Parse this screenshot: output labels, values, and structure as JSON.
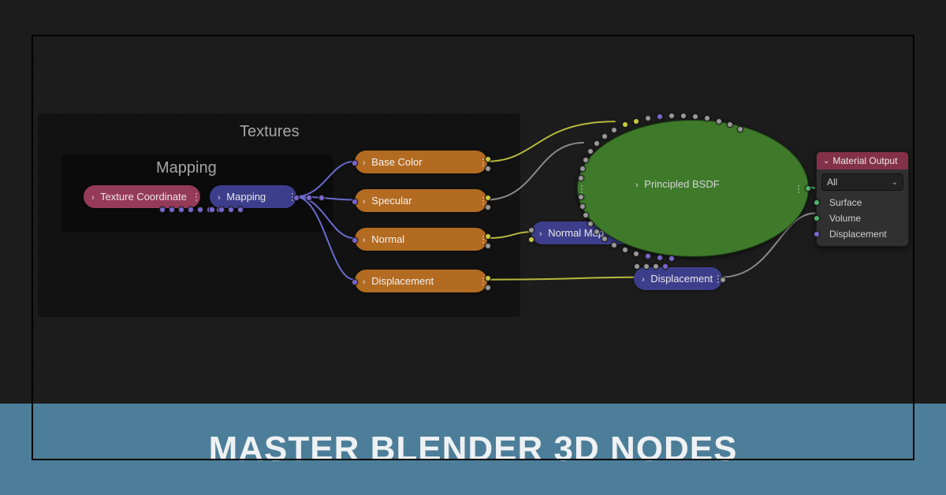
{
  "banner": {
    "title": "MASTER BLENDER 3D NODES"
  },
  "frames": {
    "textures_label": "Textures",
    "mapping_label": "Mapping"
  },
  "nodes": {
    "texcoord": "Texture Coordinate",
    "mapping": "Mapping",
    "basecolor": "Base Color",
    "specular": "Specular",
    "normal": "Normal",
    "displacement_tex": "Displacement",
    "normalmap": "Normal Map",
    "displacement": "Displacement",
    "bsdf": "Principled BSDF"
  },
  "material_output": {
    "title": "Material Output",
    "selector": "All",
    "rows": [
      "Surface",
      "Volume",
      "Displacement"
    ]
  },
  "colors": {
    "bg": "#1c1c1c",
    "banner": "#4d7e99",
    "node_red": "#963a5a",
    "node_blue": "#3d3e8b",
    "node_orange": "#b36b21",
    "node_green": "#3e7a2a",
    "header_maroon": "#83314b"
  }
}
